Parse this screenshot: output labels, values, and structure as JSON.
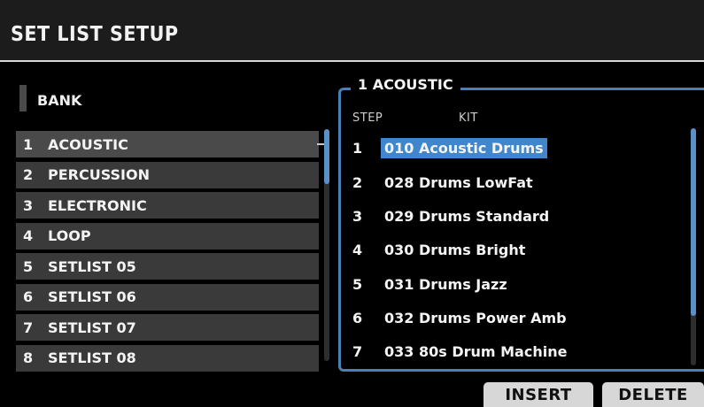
{
  "header": {
    "title": "SET LIST SETUP"
  },
  "bank": {
    "label": "BANK",
    "items": [
      {
        "num": "1",
        "name": "ACOUSTIC"
      },
      {
        "num": "2",
        "name": "PERCUSSION"
      },
      {
        "num": "3",
        "name": "ELECTRONIC"
      },
      {
        "num": "4",
        "name": "LOOP"
      },
      {
        "num": "5",
        "name": "SETLIST 05"
      },
      {
        "num": "6",
        "name": "SETLIST 06"
      },
      {
        "num": "7",
        "name": "SETLIST 07"
      },
      {
        "num": "8",
        "name": "SETLIST 08"
      }
    ],
    "selected_index": 0
  },
  "setlist": {
    "title": "1 ACOUSTIC",
    "col_step": "STEP",
    "col_kit": "KIT",
    "steps": [
      {
        "num": "1",
        "kit": "010 Acoustic Drums"
      },
      {
        "num": "2",
        "kit": "028 Drums LowFat"
      },
      {
        "num": "3",
        "kit": "029 Drums Standard"
      },
      {
        "num": "4",
        "kit": "030 Drums Bright"
      },
      {
        "num": "5",
        "kit": "031 Drums Jazz"
      },
      {
        "num": "6",
        "kit": "032 Drums Power Amb"
      },
      {
        "num": "7",
        "kit": "033 80s Drum Machine"
      }
    ],
    "selected_index": 0
  },
  "buttons": {
    "insert": "INSERT",
    "delete": "DELETE"
  },
  "colors": {
    "accent": "#3f86cc",
    "frame": "#4a7fb8",
    "row_bg": "#3a3a3a"
  }
}
